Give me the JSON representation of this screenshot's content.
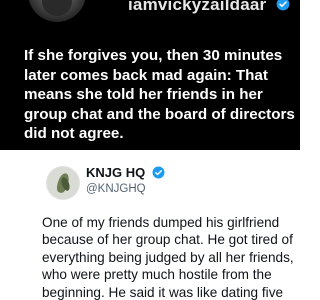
{
  "top_tweet": {
    "handle": "iamvickyzaildaar",
    "verified_icon": "verified-badge-icon",
    "text": "If she forgives you, then 30 minutes later comes back mad again: That means she told her friends in her group chat and the board of directors did not agree.",
    "colors": {
      "background": "#000000",
      "text": "#ffffff",
      "badge": "#1d9bf0"
    }
  },
  "bottom_tweet": {
    "name": "KNJG HQ",
    "handle": "@KNJGHQ",
    "verified_icon": "verified-badge-icon",
    "text": "One of my friends dumped his girlfriend because of her group chat. He got tired of everything being judged by all her friends, who were pretty much hostile from the beginning. He said it was like dating five",
    "colors": {
      "background": "#ffffff",
      "text": "#0f1419",
      "secondary": "#536471",
      "badge": "#1d9bf0"
    }
  }
}
